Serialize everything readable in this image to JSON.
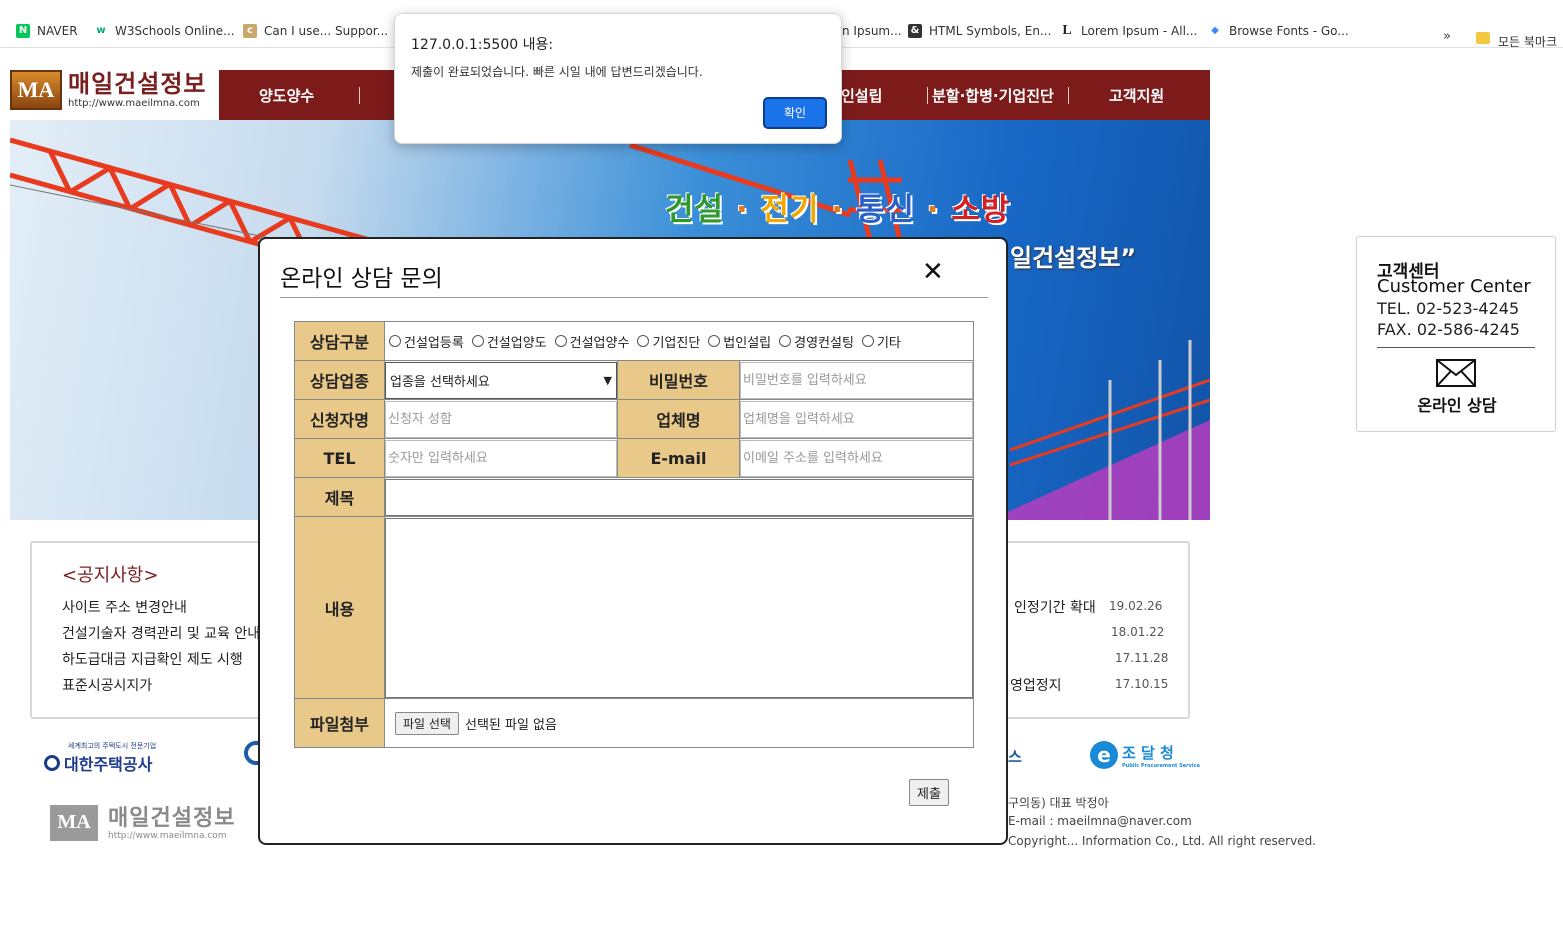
{
  "browser": {
    "bookmarks": [
      {
        "label": "NAVER",
        "icon": "N",
        "color": "#03c75a"
      },
      {
        "label": "W3Schools Online...",
        "icon": "w",
        "color": "#04aa6d"
      },
      {
        "label": "Can I use... Suppor...",
        "icon": "c",
        "color": "#c9a86b"
      },
      {
        "label": "n Ipsum...",
        "icon": "",
        "color": "#ffffff"
      },
      {
        "label": "HTML Symbols, En...",
        "icon": "&",
        "color": "#333333"
      },
      {
        "label": "Lorem Ipsum - All...",
        "icon": "L",
        "color": "#ffffff"
      },
      {
        "label": "Browse Fonts - Go...",
        "icon": "◆",
        "color": "#4285f4"
      }
    ],
    "more": "»",
    "folder_label": "모든 북마크"
  },
  "site": {
    "logo_mark": "MA",
    "logo_title": "매일건설정보",
    "logo_url": "http://www.maeilmna.com",
    "nav": [
      "양도양수",
      "인설립",
      "분할·합병·기업진단",
      "고객지원"
    ],
    "hero_slogan": [
      {
        "text": "건설",
        "color": "#2e9a2e"
      },
      {
        "text": " · ",
        "color": "#e07a1a"
      },
      {
        "text": "전기",
        "color": "#f0a800"
      },
      {
        "text": " · ",
        "color": "#e07a1a"
      },
      {
        "text": "통신",
        "color": "#2a5fc8"
      },
      {
        "text": " · ",
        "color": "#e07a1a"
      },
      {
        "text": "소방",
        "color": "#d42020"
      }
    ],
    "hero_sub": "일건설정보”"
  },
  "notice": {
    "title": "<공지사항>",
    "items": [
      "사이트 주소 변경안내",
      "건설기술자 경력관리 및 교육 안내",
      "하도급대금 지급확인 제도 시행",
      "표준시공시지가"
    ],
    "right_items": [
      {
        "text": "인정기간 확대",
        "date": "19.02.26"
      },
      {
        "text": "",
        "date": "18.01.22"
      },
      {
        "text": "",
        "date": "17.11.28"
      },
      {
        "text": "영업정지",
        "date": "17.10.15"
      }
    ]
  },
  "partners": {
    "lh": "대한주택공사",
    "lh_small": "세계최고의 주택도시 전문기업",
    "partial": "스",
    "pps": "조 달 청",
    "pps_small": "Public Procurement Service"
  },
  "footer": {
    "logo_mark": "MA",
    "title": "매일건설정보",
    "url": "http://www.maeilmna.com",
    "addr": "구의동) 대표 박정아",
    "email": "E-mail : maeilmna@naver.com",
    "copyright": "Copyright... Information Co., Ltd. All right reserved."
  },
  "customer_center": {
    "title_ko": "고객센터",
    "title_en": "Customer Center",
    "tel": "TEL. 02-523-4245",
    "fax": "FAX. 02-586-4245",
    "online": "온라인 상담"
  },
  "modal": {
    "title": "온라인 상담 문의",
    "close": "✕",
    "labels": {
      "category": "상담구분",
      "industry": "상담업종",
      "password": "비밀번호",
      "applicant": "신청자명",
      "company": "업체명",
      "tel": "TEL",
      "email": "E-mail",
      "subject": "제목",
      "content": "내용",
      "attachment": "파일첨부"
    },
    "radio_options": [
      "건설업등록",
      "건설업양도",
      "건설업양수",
      "기업진단",
      "법인설립",
      "경영컨설팅",
      "기타"
    ],
    "industry_select": "업종을 선택하세요",
    "placeholders": {
      "password": "비밀번호를 입력하세요",
      "applicant": "신청자 성함",
      "company": "업체명을 입력하세요",
      "tel": "숫자만 입력하세요",
      "email": "이메일 주소를 입력하세요"
    },
    "file_button": "파일 선택",
    "file_status": "선택된 파일 없음",
    "submit": "제출"
  },
  "alert": {
    "origin": "127.0.0.1:5500 내용:",
    "message": "제출이 완료되었습니다. 빠른 시일 내에 답변드리겠습니다.",
    "ok": "확인",
    "ok_color": "#1a73e8"
  }
}
